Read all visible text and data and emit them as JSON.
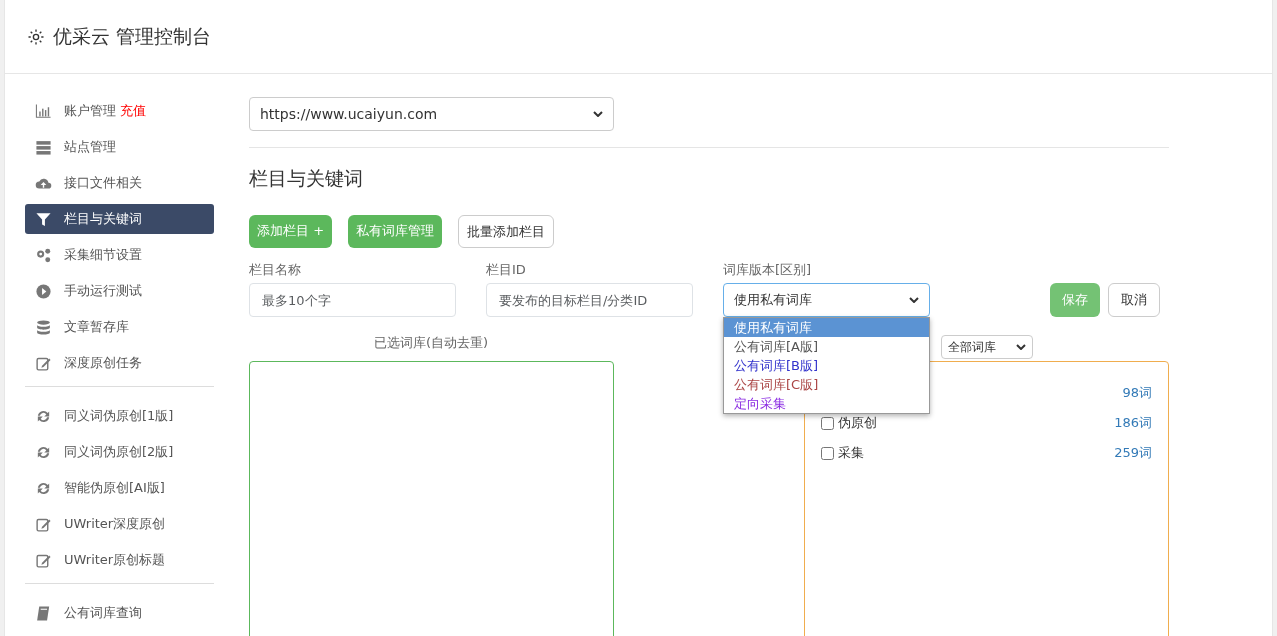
{
  "header": {
    "title": "优采云 管理控制台"
  },
  "sidebar": {
    "groups": [
      {
        "items": [
          {
            "label": "账户管理",
            "badge": "充值",
            "selected": false
          },
          {
            "label": "站点管理",
            "selected": false
          },
          {
            "label": "接口文件相关",
            "selected": false
          },
          {
            "label": "栏目与关键词",
            "selected": true
          },
          {
            "label": "采集细节设置",
            "selected": false
          },
          {
            "label": "手动运行测试",
            "selected": false
          },
          {
            "label": "文章暂存库",
            "selected": false
          },
          {
            "label": "深度原创任务",
            "selected": false
          }
        ]
      },
      {
        "items": [
          {
            "label": "同义词伪原创[1版]",
            "selected": false
          },
          {
            "label": "同义词伪原创[2版]",
            "selected": false
          },
          {
            "label": "智能伪原创[AI版]",
            "selected": false
          },
          {
            "label": "UWriter深度原创",
            "selected": false
          },
          {
            "label": "UWriter原创标题",
            "selected": false
          }
        ]
      },
      {
        "items": [
          {
            "label": "公有词库查询",
            "selected": false
          }
        ]
      }
    ]
  },
  "site_select": {
    "value": "https://www.ucaiyun.com"
  },
  "section_title": "栏目与关键词",
  "buttons": [
    {
      "label": "添加栏目 +",
      "kind": "success"
    },
    {
      "label": "私有词库管理",
      "kind": "success"
    },
    {
      "label": "批量添加栏目",
      "kind": "outline"
    }
  ],
  "form": {
    "fields": [
      {
        "label": "栏目名称",
        "placeholder": "最多10个字",
        "kind": "input"
      },
      {
        "label": "栏目ID",
        "placeholder": "要发布的目标栏目/分类ID",
        "kind": "input"
      },
      {
        "label": "词库版本[区别]",
        "value": "使用私有词库",
        "kind": "select",
        "expanded": true,
        "options": [
          {
            "label": "使用私有词库",
            "selected": true
          },
          {
            "label": "公有词库[A版]",
            "selected": false,
            "color": "#555555"
          },
          {
            "label": "公有词库[B版]",
            "selected": false,
            "color": "#3333cc"
          },
          {
            "label": "公有词库[C版]",
            "selected": false,
            "color": "#aa4444"
          },
          {
            "label": "定向采集",
            "selected": false,
            "color": "#8a2be2"
          }
        ]
      }
    ],
    "save": "保存",
    "cancel": "取消"
  },
  "selected_lib": {
    "label": "已选词库(自动去重)"
  },
  "lib_filter": {
    "value": "全部词库"
  },
  "libraries": [
    {
      "count": "98词"
    },
    {
      "label": "伪原创",
      "count": "186词",
      "checked": false
    },
    {
      "label": "采集",
      "count": "259词",
      "checked": false
    }
  ]
}
